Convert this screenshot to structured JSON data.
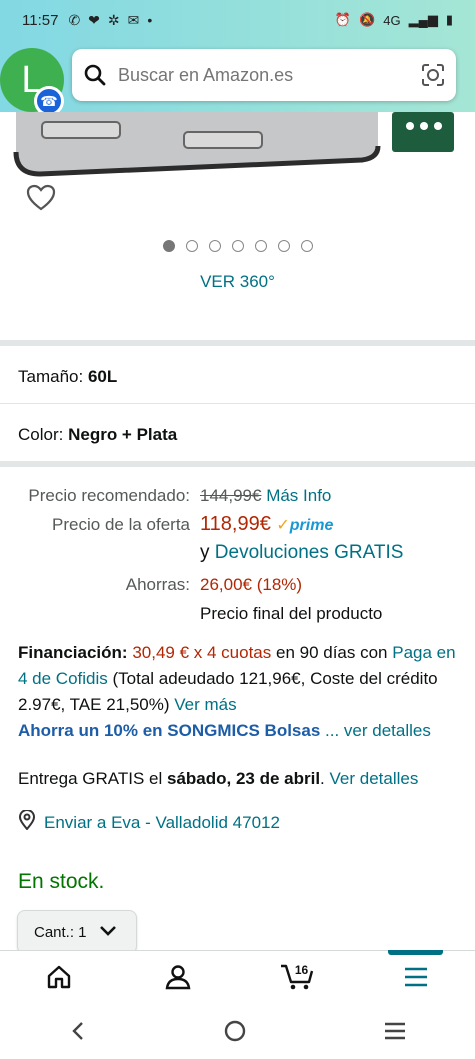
{
  "status_bar": {
    "time": "11:57",
    "network": "4G"
  },
  "avatar": {
    "letter": "L"
  },
  "search": {
    "placeholder": "Buscar en Amazon.es"
  },
  "gallery": {
    "image_count": 7,
    "active_index": 0,
    "view360_label": "VER 360°"
  },
  "size": {
    "label": "Tamaño:",
    "value": "60L"
  },
  "color": {
    "label": "Color:",
    "value": "Negro + Plata"
  },
  "pricing": {
    "recommended_label": "Precio recomendado:",
    "recommended_value": "144,99€",
    "more_info": "Más Info",
    "offer_label": "Precio de la oferta",
    "offer_value": "118,99€",
    "prime": "prime",
    "returns_prefix": "y",
    "returns_link": "Devoluciones GRATIS",
    "savings_label": "Ahorras:",
    "savings_value": "26,00€ (18%)",
    "final_note": "Precio final del producto"
  },
  "financing": {
    "label": "Financiación:",
    "amount": "30,49 € x 4 cuotas",
    "after_amount": "en 90 días con",
    "provider_link": "Paga en 4 de Cofidis",
    "details": "(Total adeudado 121,96€, Coste del crédito 2.97€, TAE 21,50%)",
    "ver_mas": "Ver más",
    "promo": "Ahorra un 10% en SONGMICS Bolsas",
    "promo_more": "... ver detalles"
  },
  "delivery": {
    "prefix": "Entrega GRATIS el",
    "date": "sábado, 23 de abril",
    "link": "Ver detalles",
    "address": "Enviar a Eva - Valladolid 47012"
  },
  "stock": "En stock.",
  "quantity": {
    "label": "Cant.: 1"
  },
  "bottom_nav": {
    "cart_count": "16",
    "active": "menu"
  }
}
